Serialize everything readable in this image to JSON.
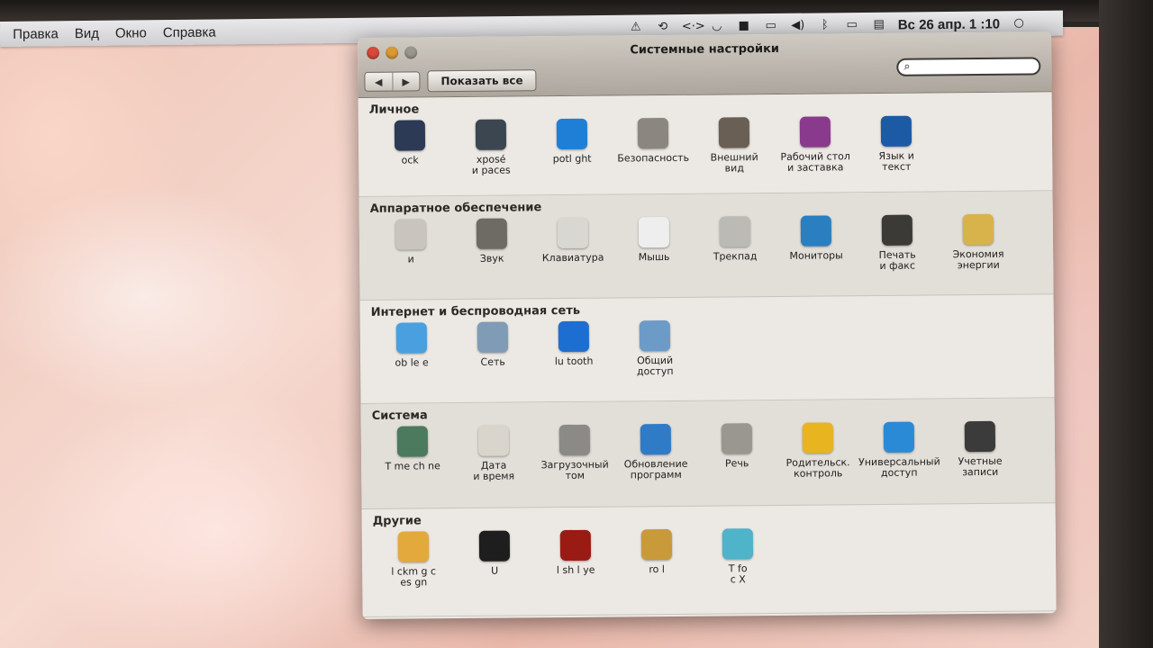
{
  "menubar": {
    "items": [
      "Правка",
      "Вид",
      "Окно",
      "Справка"
    ],
    "clock": "Вс 26 апр. 1 :10"
  },
  "window": {
    "title": "Системные настройки",
    "show_all_label": "Показать все",
    "search_placeholder": "",
    "search_value": ""
  },
  "sections": [
    {
      "title": "Личное",
      "items": [
        {
          "label": "ock",
          "icon": "dock-icon",
          "color": "#2d3a55"
        },
        {
          "label": "xposé\nи paces",
          "icon": "expose-icon",
          "color": "#3b4650"
        },
        {
          "label": "potl ght",
          "icon": "spotlight-icon",
          "color": "#1f7fd6"
        },
        {
          "label": "Безопасность",
          "icon": "house-lock-icon",
          "color": "#8b8780"
        },
        {
          "label": "Внешний\nвид",
          "icon": "appearance-icon",
          "color": "#6a5f55"
        },
        {
          "label": "Рабочий стол\nи заставка",
          "icon": "desktop-icon",
          "color": "#8a3a8c"
        },
        {
          "label": "Язык и\nтекст",
          "icon": "flag-icon",
          "color": "#1c5aa6"
        }
      ]
    },
    {
      "title": "Аппаратное обеспечение",
      "items": [
        {
          "label": "  и  ",
          "icon": "cd-icon",
          "color": "#c9c4bd"
        },
        {
          "label": "Звук",
          "icon": "speaker-icon",
          "color": "#6e6a64"
        },
        {
          "label": "Клавиатура",
          "icon": "keyboard-icon",
          "color": "#d9d7d2"
        },
        {
          "label": "Мышь",
          "icon": "mouse-icon",
          "color": "#eeeeee"
        },
        {
          "label": "Трекпад",
          "icon": "trackpad-icon",
          "color": "#bcbab5"
        },
        {
          "label": "Мониторы",
          "icon": "monitor-icon",
          "color": "#2a7fc0"
        },
        {
          "label": "Печать\nи факс",
          "icon": "printer-icon",
          "color": "#3c3a37"
        },
        {
          "label": "Экономия\nэнергии",
          "icon": "bulb-icon",
          "color": "#d8b24a"
        }
      ]
    },
    {
      "title": "Интернет и беспроводная сеть",
      "items": [
        {
          "label": "ob le e",
          "icon": "mobileme-icon",
          "color": "#4aa0de"
        },
        {
          "label": "Сеть",
          "icon": "globe-icon",
          "color": "#7f9bb5"
        },
        {
          "label": "lu tooth",
          "icon": "bluetooth-icon",
          "color": "#1c6fd0"
        },
        {
          "label": "Общий\nдоступ",
          "icon": "sharing-folder-icon",
          "color": "#6d9bc8"
        }
      ]
    },
    {
      "title": "Система",
      "items": [
        {
          "label": "T me  ch ne",
          "icon": "time-machine-icon",
          "color": "#4c7a5e"
        },
        {
          "label": "Дата\nи время",
          "icon": "clock-icon",
          "color": "#d9d4cc"
        },
        {
          "label": "Загрузочный\nтом",
          "icon": "disk-icon",
          "color": "#8c8a86"
        },
        {
          "label": "Обновление\nпрограмм",
          "icon": "update-icon",
          "color": "#2f7bc6"
        },
        {
          "label": "Речь",
          "icon": "microphone-icon",
          "color": "#9a9690"
        },
        {
          "label": "Родительск.\nконтроль",
          "icon": "parental-icon",
          "color": "#e8b520"
        },
        {
          "label": "Универсальный\nдоступ",
          "icon": "accessibility-icon",
          "color": "#2a8ad6"
        },
        {
          "label": "Учетные\nзаписи",
          "icon": "accounts-icon",
          "color": "#3b3b3b"
        }
      ]
    },
    {
      "title": "Другие",
      "items": [
        {
          "label": "l ckm g c\n es gn",
          "icon": "overlap-icon",
          "color": "#e3a93c"
        },
        {
          "label": "U",
          "icon": "nvidia-icon",
          "color": "#1e1e1e"
        },
        {
          "label": "l sh  l ye",
          "icon": "flash-icon",
          "color": "#9a1b14"
        },
        {
          "label": "ro l",
          "icon": "growl-icon",
          "color": "#c89a3a"
        },
        {
          "label": "T  fo\n c X",
          "icon": "ntfs-icon",
          "color": "#4fb3c9"
        }
      ]
    }
  ]
}
